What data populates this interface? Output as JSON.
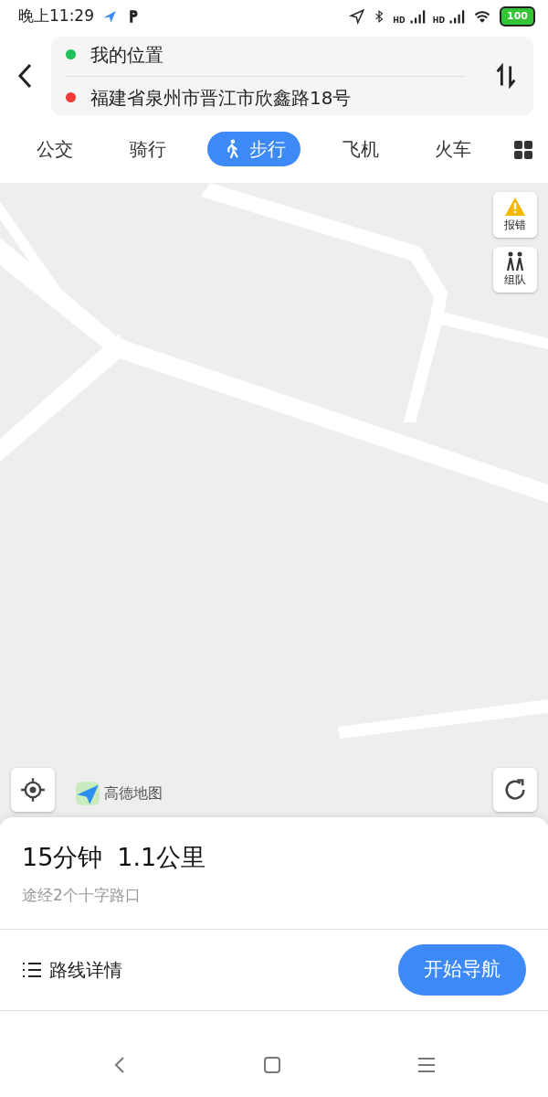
{
  "status_bar": {
    "time": "晚上11:29",
    "signal_labels": [
      "HD",
      "HD"
    ],
    "battery": "100"
  },
  "route": {
    "origin": "我的位置",
    "destination": "福建省泉州市晋江市欣鑫路18号"
  },
  "modes": [
    {
      "label": "公交",
      "selected": false
    },
    {
      "label": "骑行",
      "selected": false
    },
    {
      "label": "步行",
      "selected": true
    },
    {
      "label": "飞机",
      "selected": false
    },
    {
      "label": "火车",
      "selected": false
    }
  ],
  "map": {
    "kind": "picture",
    "tools": [
      {
        "label": "报错",
        "kind": "warning"
      },
      {
        "label": "组队",
        "kind": "team"
      }
    ],
    "logo": "高德地图"
  },
  "summary": {
    "duration": "15分钟",
    "distance": "1.1公里",
    "note": "途经2个十字路口"
  },
  "details_button": "路线详情",
  "navigate_button": "开始导航"
}
